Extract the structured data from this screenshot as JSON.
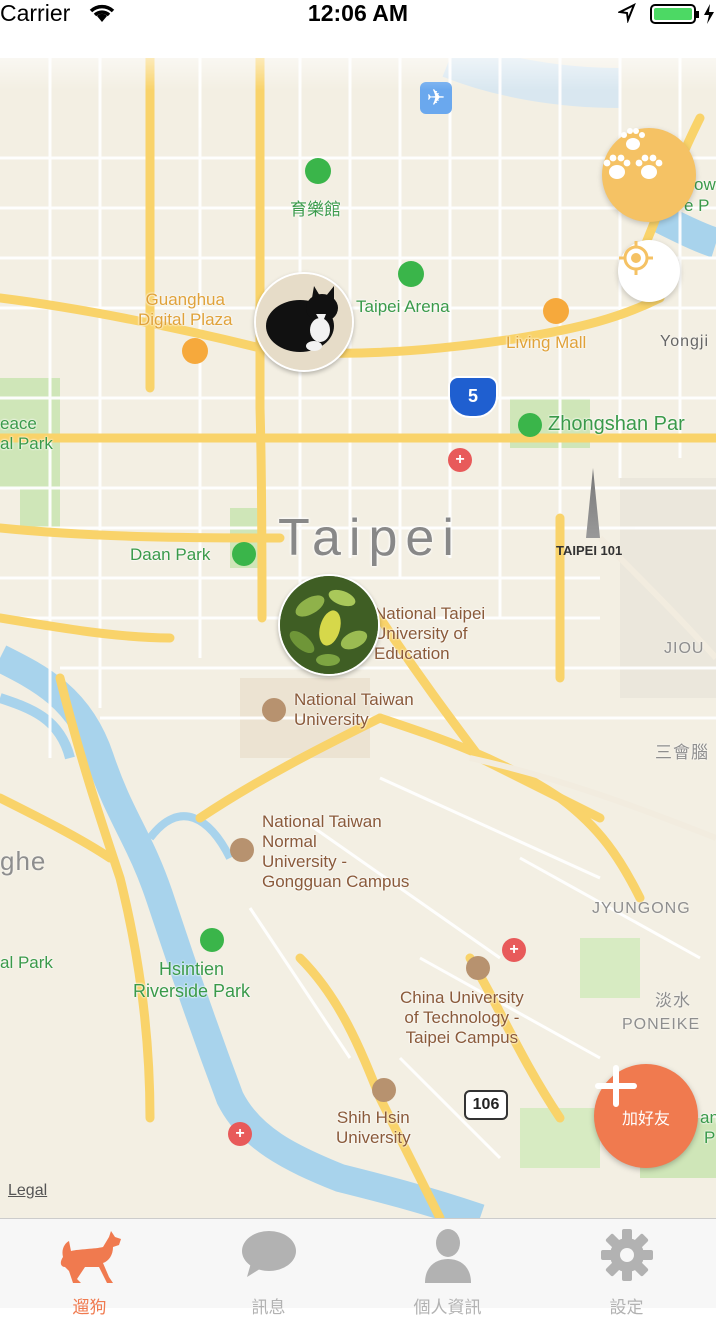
{
  "status_bar": {
    "carrier": "Carrier",
    "time": "12:06 AM"
  },
  "map": {
    "city_label": "Taipei",
    "airport": "Taipei Songshan\nAirport (TSA)",
    "labels": {
      "yuyueguan": "育樂館",
      "taipei_arena": "Taipei Arena",
      "guanghua": "Guanghua\nDigital Plaza",
      "living_mall": "Living Mall",
      "yongji": "Yongji",
      "peace_park": "eace\nal Park",
      "zhongshan_park": "Zhongshan Par",
      "taipei101": "TAIPEI 101",
      "daan_park": "Daan Park",
      "ntue": "National Taipei\nUniversity of\nEducation",
      "jiou": "JIOU",
      "ntu": "National Taiwan\nUniversity",
      "sanhui": "三會腦",
      "ntnu": "National Taiwan\nNormal\nUniversity -\nGongguan Campus",
      "ghe": "ghe",
      "jyungong": "JYUNGONG",
      "al_park": "al Park",
      "hsintien": "Hsintien\nRiverside Park",
      "china_univ": "China University\nof Technology -\nTaipei Campus",
      "danshui": "淡水",
      "poneike": "PONEIKE",
      "shih_hsin": "Shih Hsin\nUniversity",
      "route5": "5",
      "route106": "106",
      "legal": "Legal",
      "ow": "ow",
      "ep": "e P",
      "an": "an",
      "p2": "P"
    }
  },
  "fab": {
    "add_friend": "加好友"
  },
  "tabs": [
    {
      "label": "遛狗",
      "icon": "dog-icon",
      "active": true
    },
    {
      "label": "訊息",
      "icon": "chat-bubble-icon",
      "active": false
    },
    {
      "label": "個人資訊",
      "icon": "person-icon",
      "active": false
    },
    {
      "label": "設定",
      "icon": "gear-icon",
      "active": false
    }
  ],
  "colors": {
    "accent": "#f07a4f",
    "paw_button": "#f5c264",
    "tab_inactive": "#b2b2b2",
    "road": "#f9d36a"
  }
}
